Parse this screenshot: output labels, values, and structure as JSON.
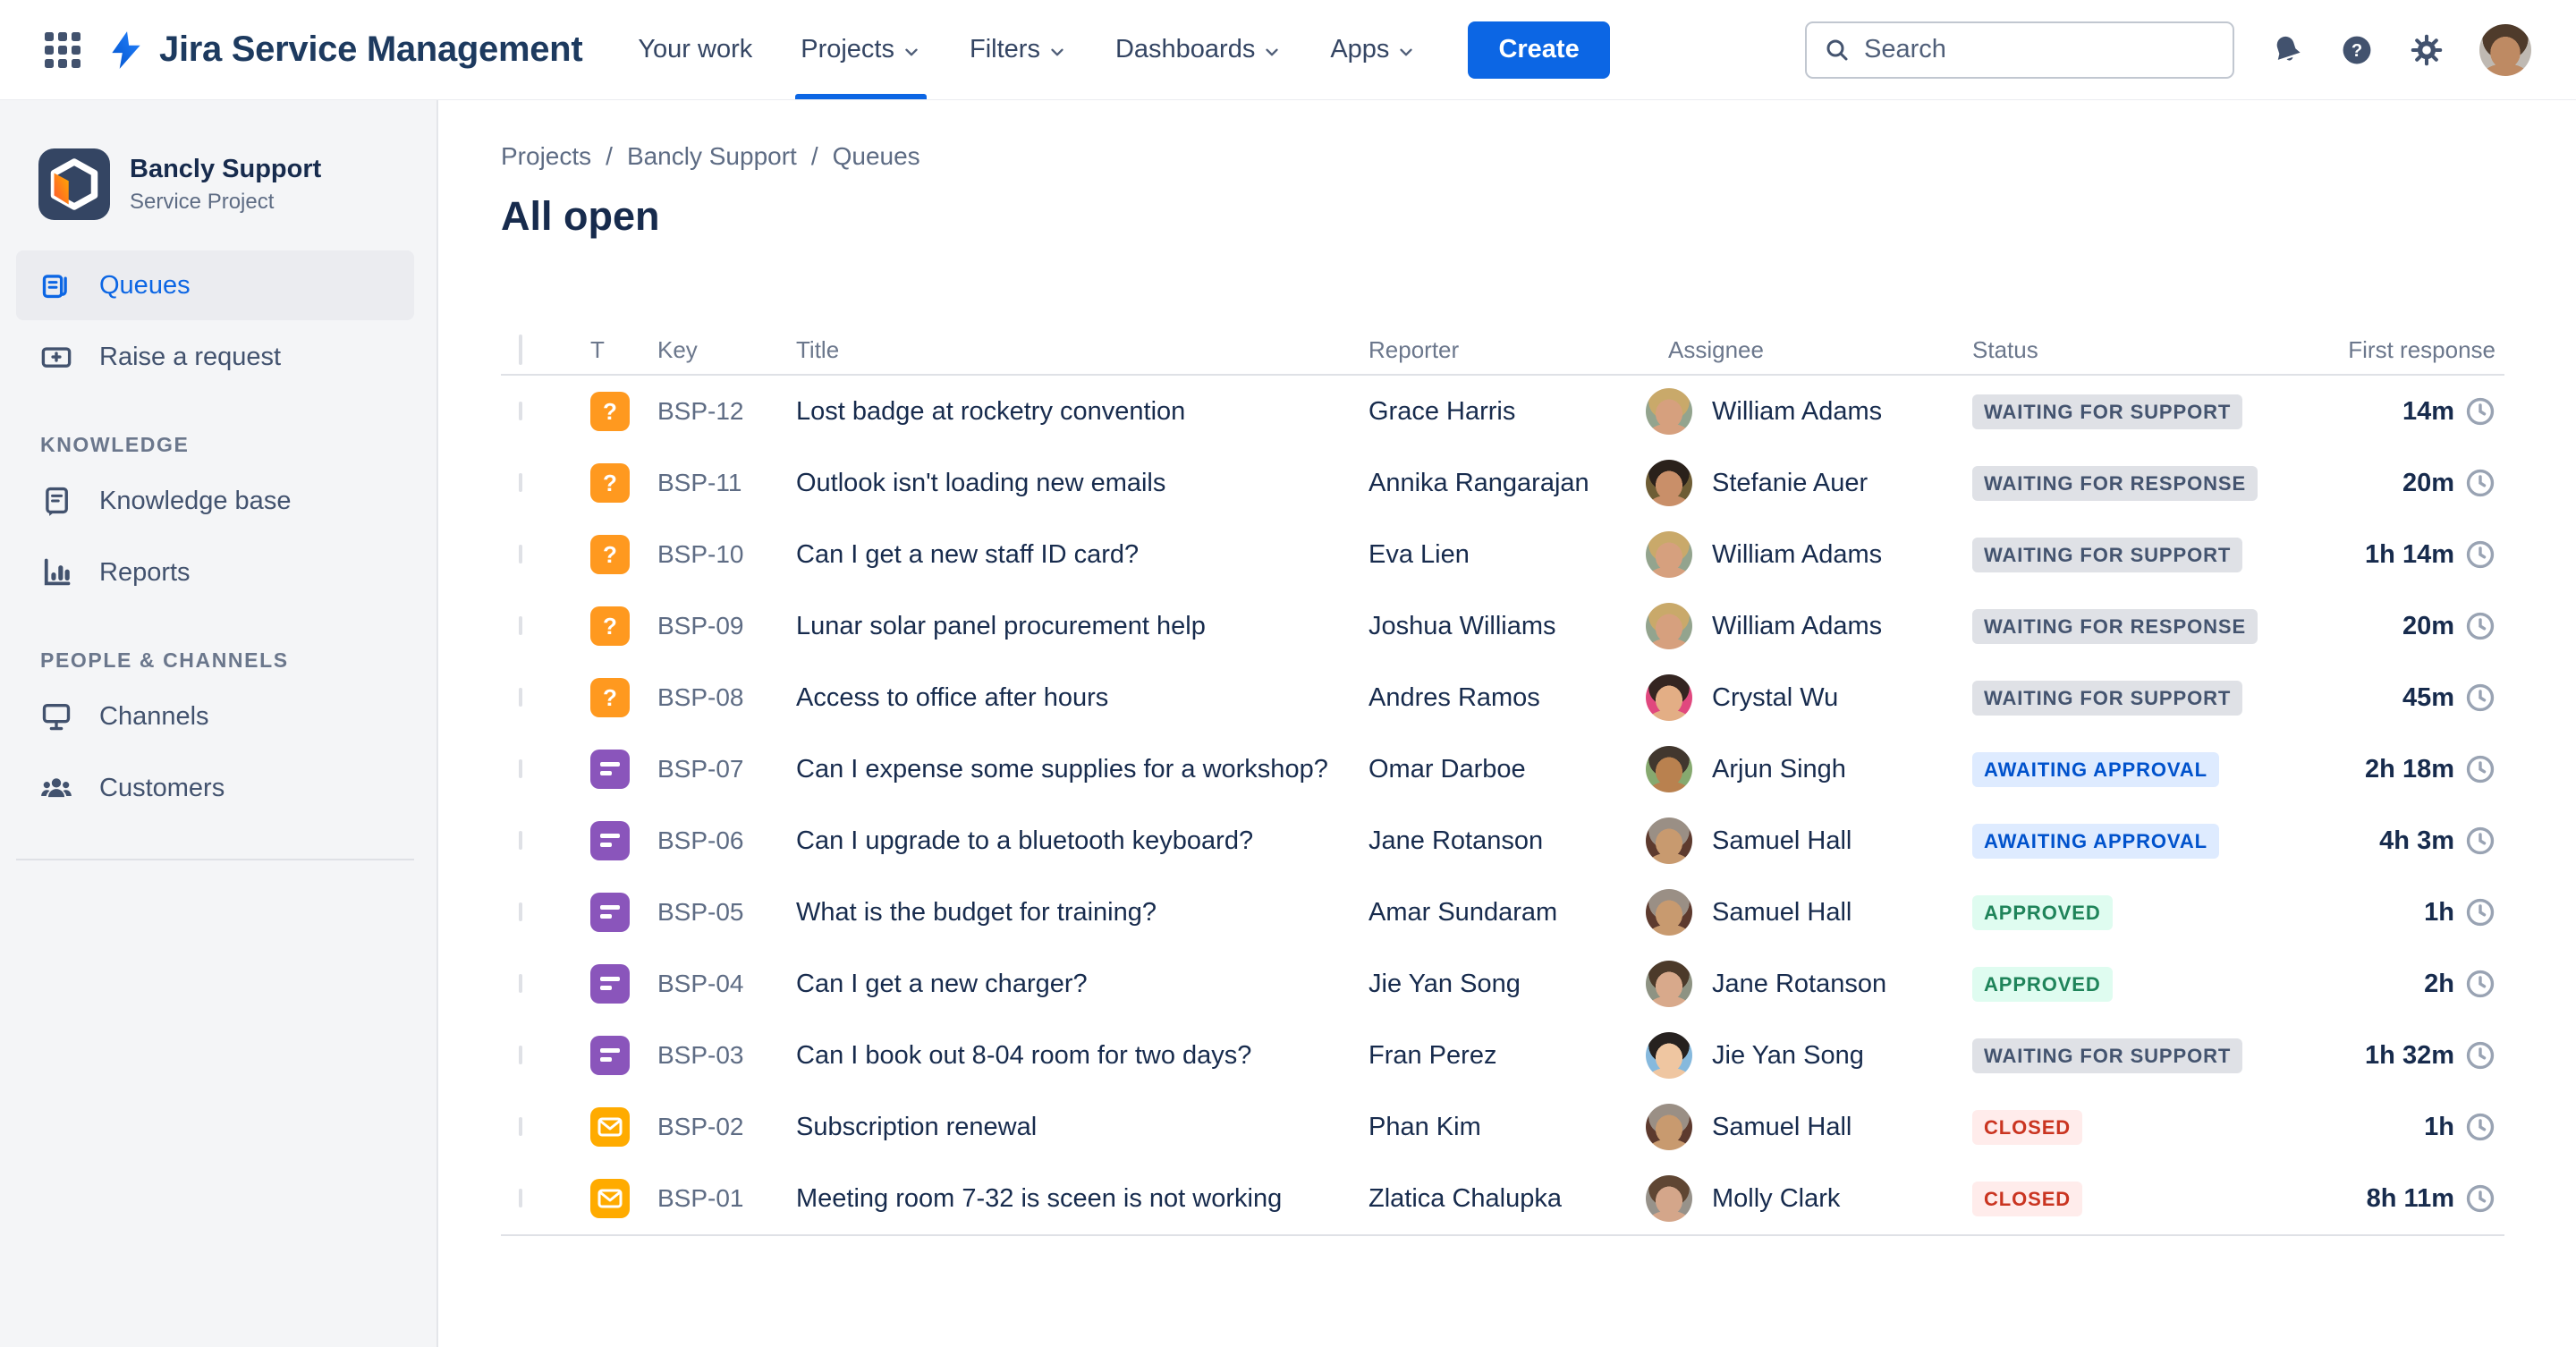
{
  "nav": {
    "app_name": "Jira Service Management",
    "items": [
      {
        "label": "Your work",
        "chevron": false,
        "active": false
      },
      {
        "label": "Projects",
        "chevron": true,
        "active": true
      },
      {
        "label": "Filters",
        "chevron": true,
        "active": false
      },
      {
        "label": "Dashboards",
        "chevron": true,
        "active": false
      },
      {
        "label": "Apps",
        "chevron": true,
        "active": false
      }
    ],
    "create_label": "Create",
    "search_placeholder": "Search",
    "user_avatar": {
      "bg": "#BFB9B2",
      "hair": "#4F3B2B",
      "skin": "#BE8A63"
    }
  },
  "sidebar": {
    "project_name": "Bancly Support",
    "project_type": "Service Project",
    "primary_items": [
      {
        "label": "Queues",
        "icon": "queues",
        "active": true
      },
      {
        "label": "Raise a request",
        "icon": "raise-request",
        "active": false
      }
    ],
    "sections": [
      {
        "title": "KNOWLEDGE",
        "items": [
          {
            "label": "Knowledge base",
            "icon": "knowledge-base",
            "active": false
          },
          {
            "label": "Reports",
            "icon": "reports",
            "active": false
          }
        ]
      },
      {
        "title": "PEOPLE & CHANNELS",
        "items": [
          {
            "label": "Channels",
            "icon": "channels",
            "active": false
          },
          {
            "label": "Customers",
            "icon": "customers",
            "active": false
          }
        ]
      }
    ]
  },
  "breadcrumb": [
    "Projects",
    "Bancly Support",
    "Queues"
  ],
  "page_title": "All open",
  "table": {
    "columns": {
      "type": "T",
      "key": "Key",
      "title": "Title",
      "reporter": "Reporter",
      "assignee": "Assignee",
      "status": "Status",
      "first_response": "First response"
    },
    "rows": [
      {
        "key": "BSP-12",
        "type": "question",
        "title": "Lost badge at rocketry convention",
        "reporter": "Grace Harris",
        "assignee": "William Adams",
        "status": "WAITING FOR SUPPORT",
        "status_color": "gray",
        "first_response": "14m",
        "avatar": {
          "bg": "#93A48E",
          "hair": "#C9A96A",
          "skin": "#D6A07E"
        }
      },
      {
        "key": "BSP-11",
        "type": "question",
        "title": "Outlook isn't loading new emails",
        "reporter": "Annika Rangarajan",
        "assignee": "Stefanie Auer",
        "status": "WAITING FOR RESPONSE",
        "status_color": "gray",
        "first_response": "20m",
        "avatar": {
          "bg": "#6E5D35",
          "hair": "#2A211B",
          "skin": "#C98F69"
        }
      },
      {
        "key": "BSP-10",
        "type": "question",
        "title": "Can I get a new staff ID card?",
        "reporter": "Eva Lien",
        "assignee": "William Adams",
        "status": "WAITING FOR SUPPORT",
        "status_color": "gray",
        "first_response": "1h 14m",
        "avatar": {
          "bg": "#93A48E",
          "hair": "#C9A96A",
          "skin": "#D6A07E"
        }
      },
      {
        "key": "BSP-09",
        "type": "question",
        "title": "Lunar solar panel procurement help",
        "reporter": "Joshua Williams",
        "assignee": "William Adams",
        "status": "WAITING FOR RESPONSE",
        "status_color": "gray",
        "first_response": "20m",
        "avatar": {
          "bg": "#93A48E",
          "hair": "#C9A96A",
          "skin": "#D6A07E"
        }
      },
      {
        "key": "BSP-08",
        "type": "question",
        "title": "Access to office after hours",
        "reporter": "Andres Ramos",
        "assignee": "Crystal Wu",
        "status": "WAITING FOR SUPPORT",
        "status_color": "gray",
        "first_response": "45m",
        "avatar": {
          "bg": "#E0487E",
          "hair": "#342521",
          "skin": "#E3AE85"
        }
      },
      {
        "key": "BSP-07",
        "type": "request",
        "title": "Can I expense some supplies for a workshop?",
        "reporter": "Omar Darboe",
        "assignee": "Arjun Singh",
        "status": "AWAITING APPROVAL",
        "status_color": "blue",
        "first_response": "2h 18m",
        "avatar": {
          "bg": "#86A96F",
          "hair": "#41372E",
          "skin": "#B9814F"
        }
      },
      {
        "key": "BSP-06",
        "type": "request",
        "title": "Can I upgrade to a bluetooth keyboard?",
        "reporter": "Jane Rotanson",
        "assignee": "Samuel Hall",
        "status": "AWAITING APPROVAL",
        "status_color": "blue",
        "first_response": "4h 3m",
        "avatar": {
          "bg": "#5D3A2E",
          "hair": "#9A8F85",
          "skin": "#C89A6F"
        }
      },
      {
        "key": "BSP-05",
        "type": "request",
        "title": "What is the budget for training?",
        "reporter": "Amar Sundaram",
        "assignee": "Samuel Hall",
        "status": "APPROVED",
        "status_color": "green",
        "first_response": "1h",
        "avatar": {
          "bg": "#5D3A2E",
          "hair": "#9A8F85",
          "skin": "#C89A6F"
        }
      },
      {
        "key": "BSP-04",
        "type": "request",
        "title": "Can I get a new charger?",
        "reporter": "Jie Yan Song",
        "assignee": "Jane Rotanson",
        "status": "APPROVED",
        "status_color": "green",
        "first_response": "2h",
        "avatar": {
          "bg": "#8E9383",
          "hair": "#4C3A2A",
          "skin": "#D8A98B"
        }
      },
      {
        "key": "BSP-03",
        "type": "request",
        "title": "Can I book out 8-04 room for two days?",
        "reporter": "Fran Perez",
        "assignee": "Jie Yan Song",
        "status": "WAITING FOR SUPPORT",
        "status_color": "gray",
        "first_response": "1h 32m",
        "avatar": {
          "bg": "#86B9DD",
          "hair": "#26211F",
          "skin": "#EFC6A1"
        }
      },
      {
        "key": "BSP-02",
        "type": "email",
        "title": "Subscription renewal",
        "reporter": "Phan Kim",
        "assignee": "Samuel Hall",
        "status": "CLOSED",
        "status_color": "red",
        "first_response": "1h",
        "avatar": {
          "bg": "#5D3A2E",
          "hair": "#9A8F85",
          "skin": "#C89A6F"
        }
      },
      {
        "key": "BSP-01",
        "type": "email",
        "title": "Meeting room 7-32 is sceen is not working",
        "reporter": "Zlatica Chalupka",
        "assignee": "Molly Clark",
        "status": "CLOSED",
        "status_color": "red",
        "first_response": "8h 11m",
        "avatar": {
          "bg": "#97928A",
          "hair": "#5F4633",
          "skin": "#D4A68A"
        }
      }
    ]
  },
  "colors": {
    "accent_blue": "#0C66E4",
    "type_question": "#FF991F",
    "type_request": "#8A55BB",
    "type_email": "#FFAB00",
    "sidebar_bg": "#F4F5F7"
  }
}
